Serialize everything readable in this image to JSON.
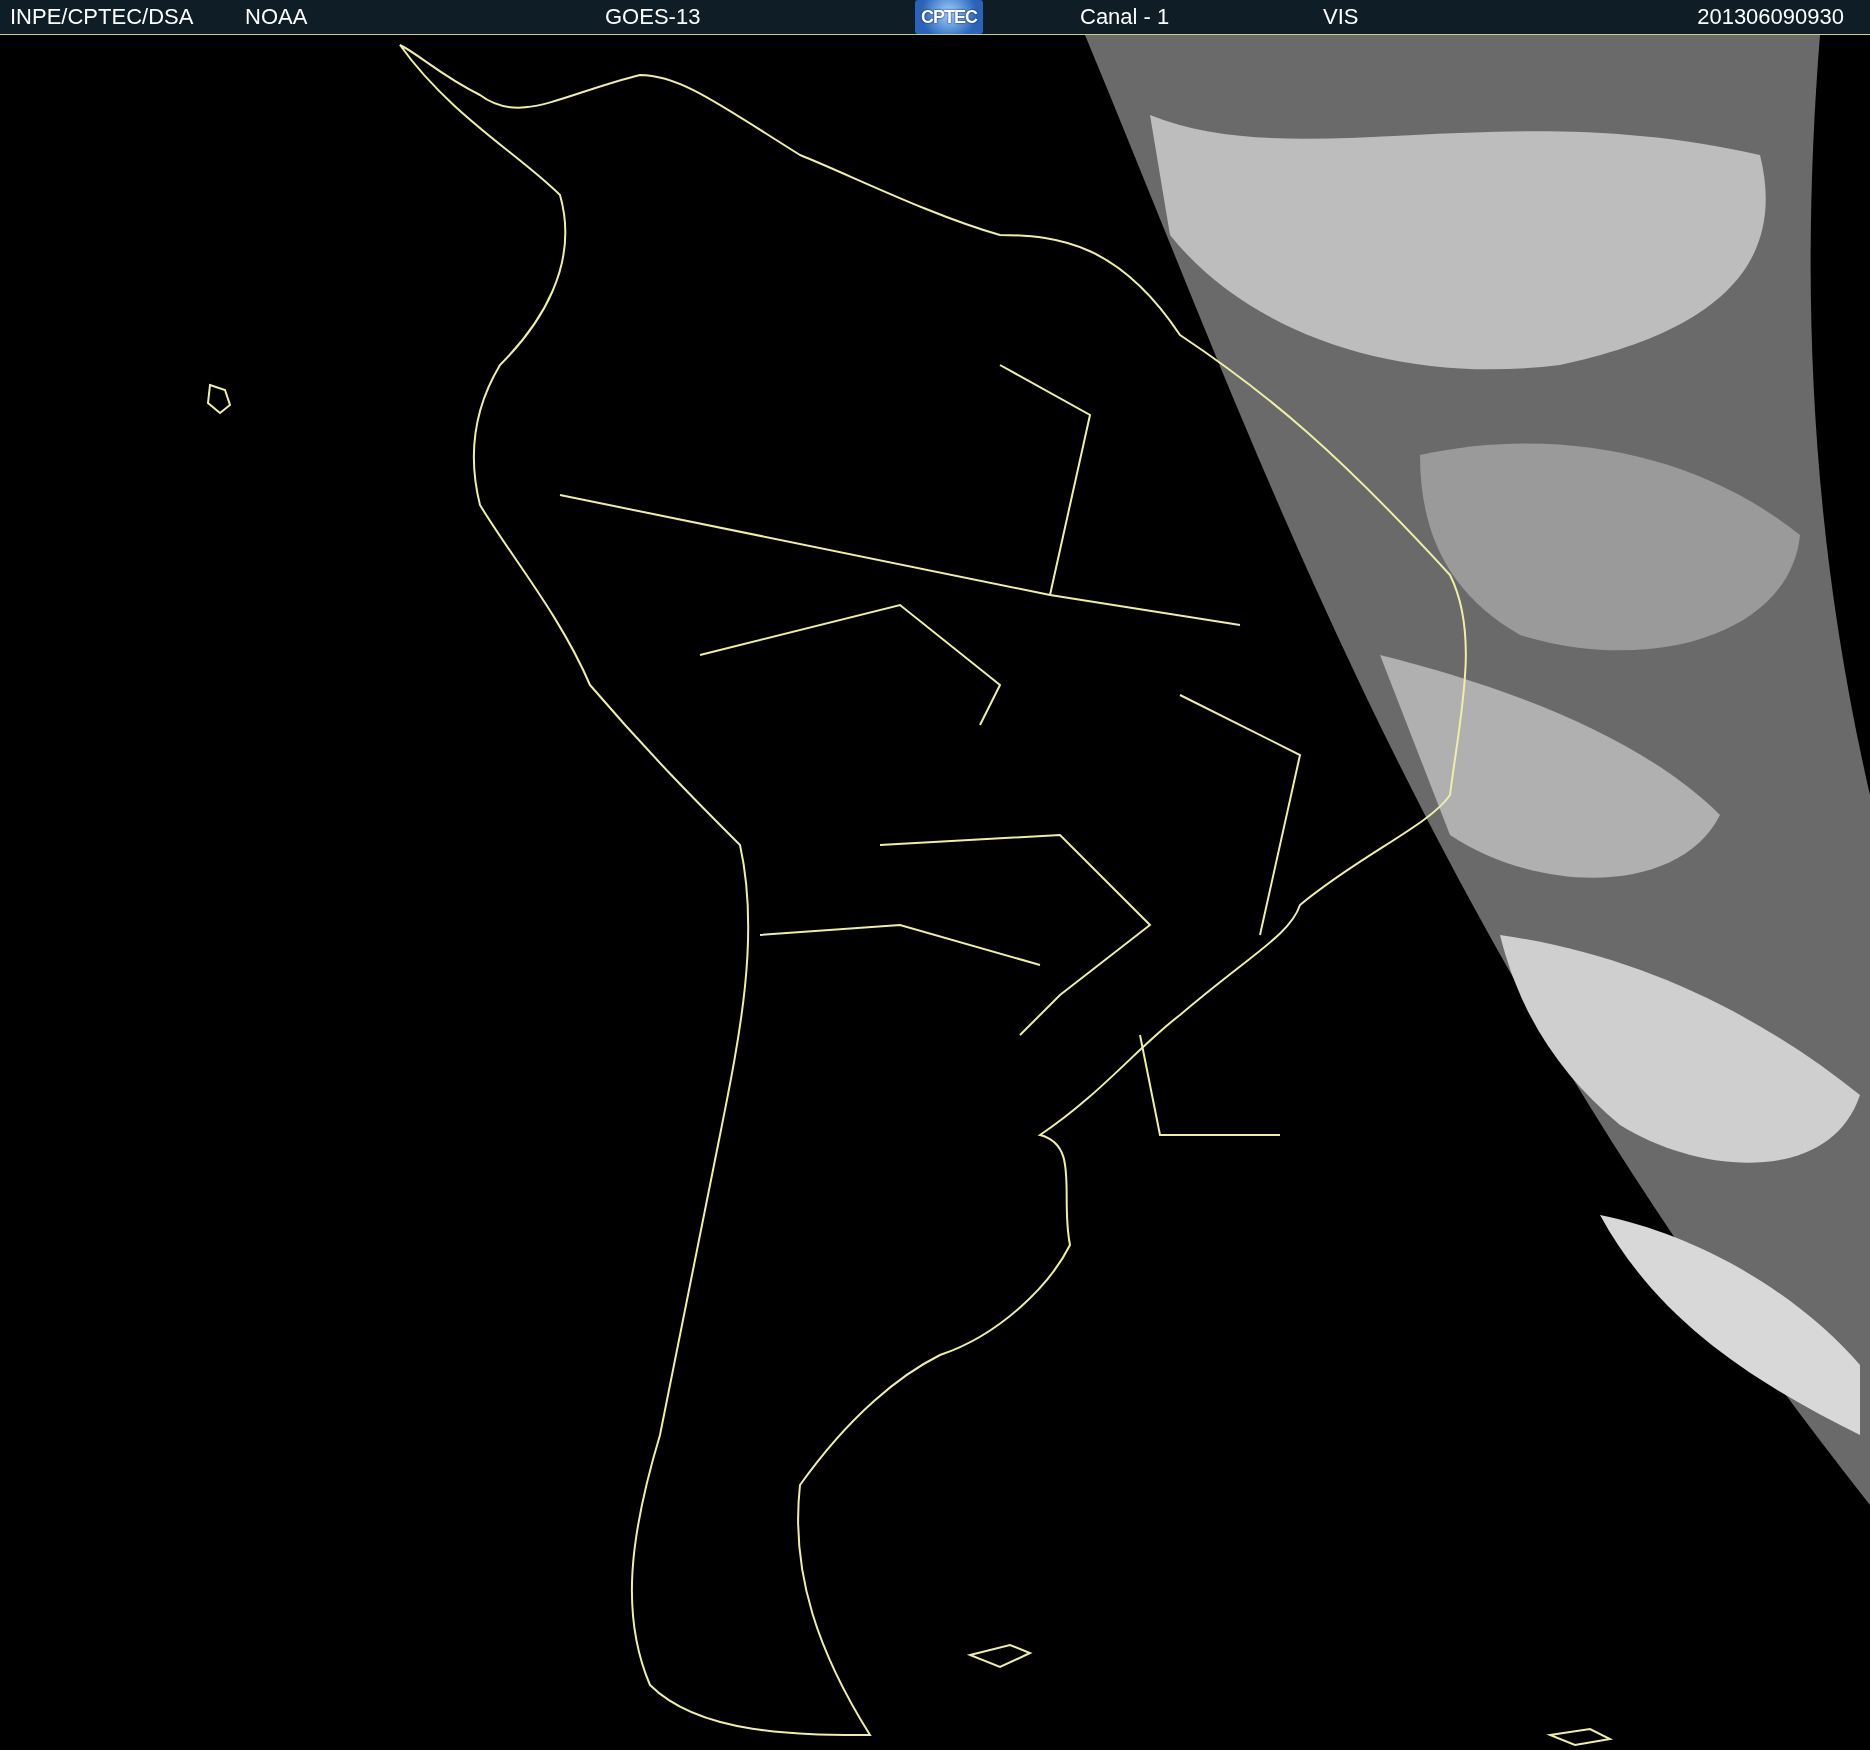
{
  "header": {
    "source": "INPE/CPTEC/DSA",
    "agency": "NOAA",
    "satellite": "GOES-13",
    "logo": "CPTEC",
    "channel": "Canal - 1",
    "band": "VIS",
    "timestamp": "201306090930"
  }
}
